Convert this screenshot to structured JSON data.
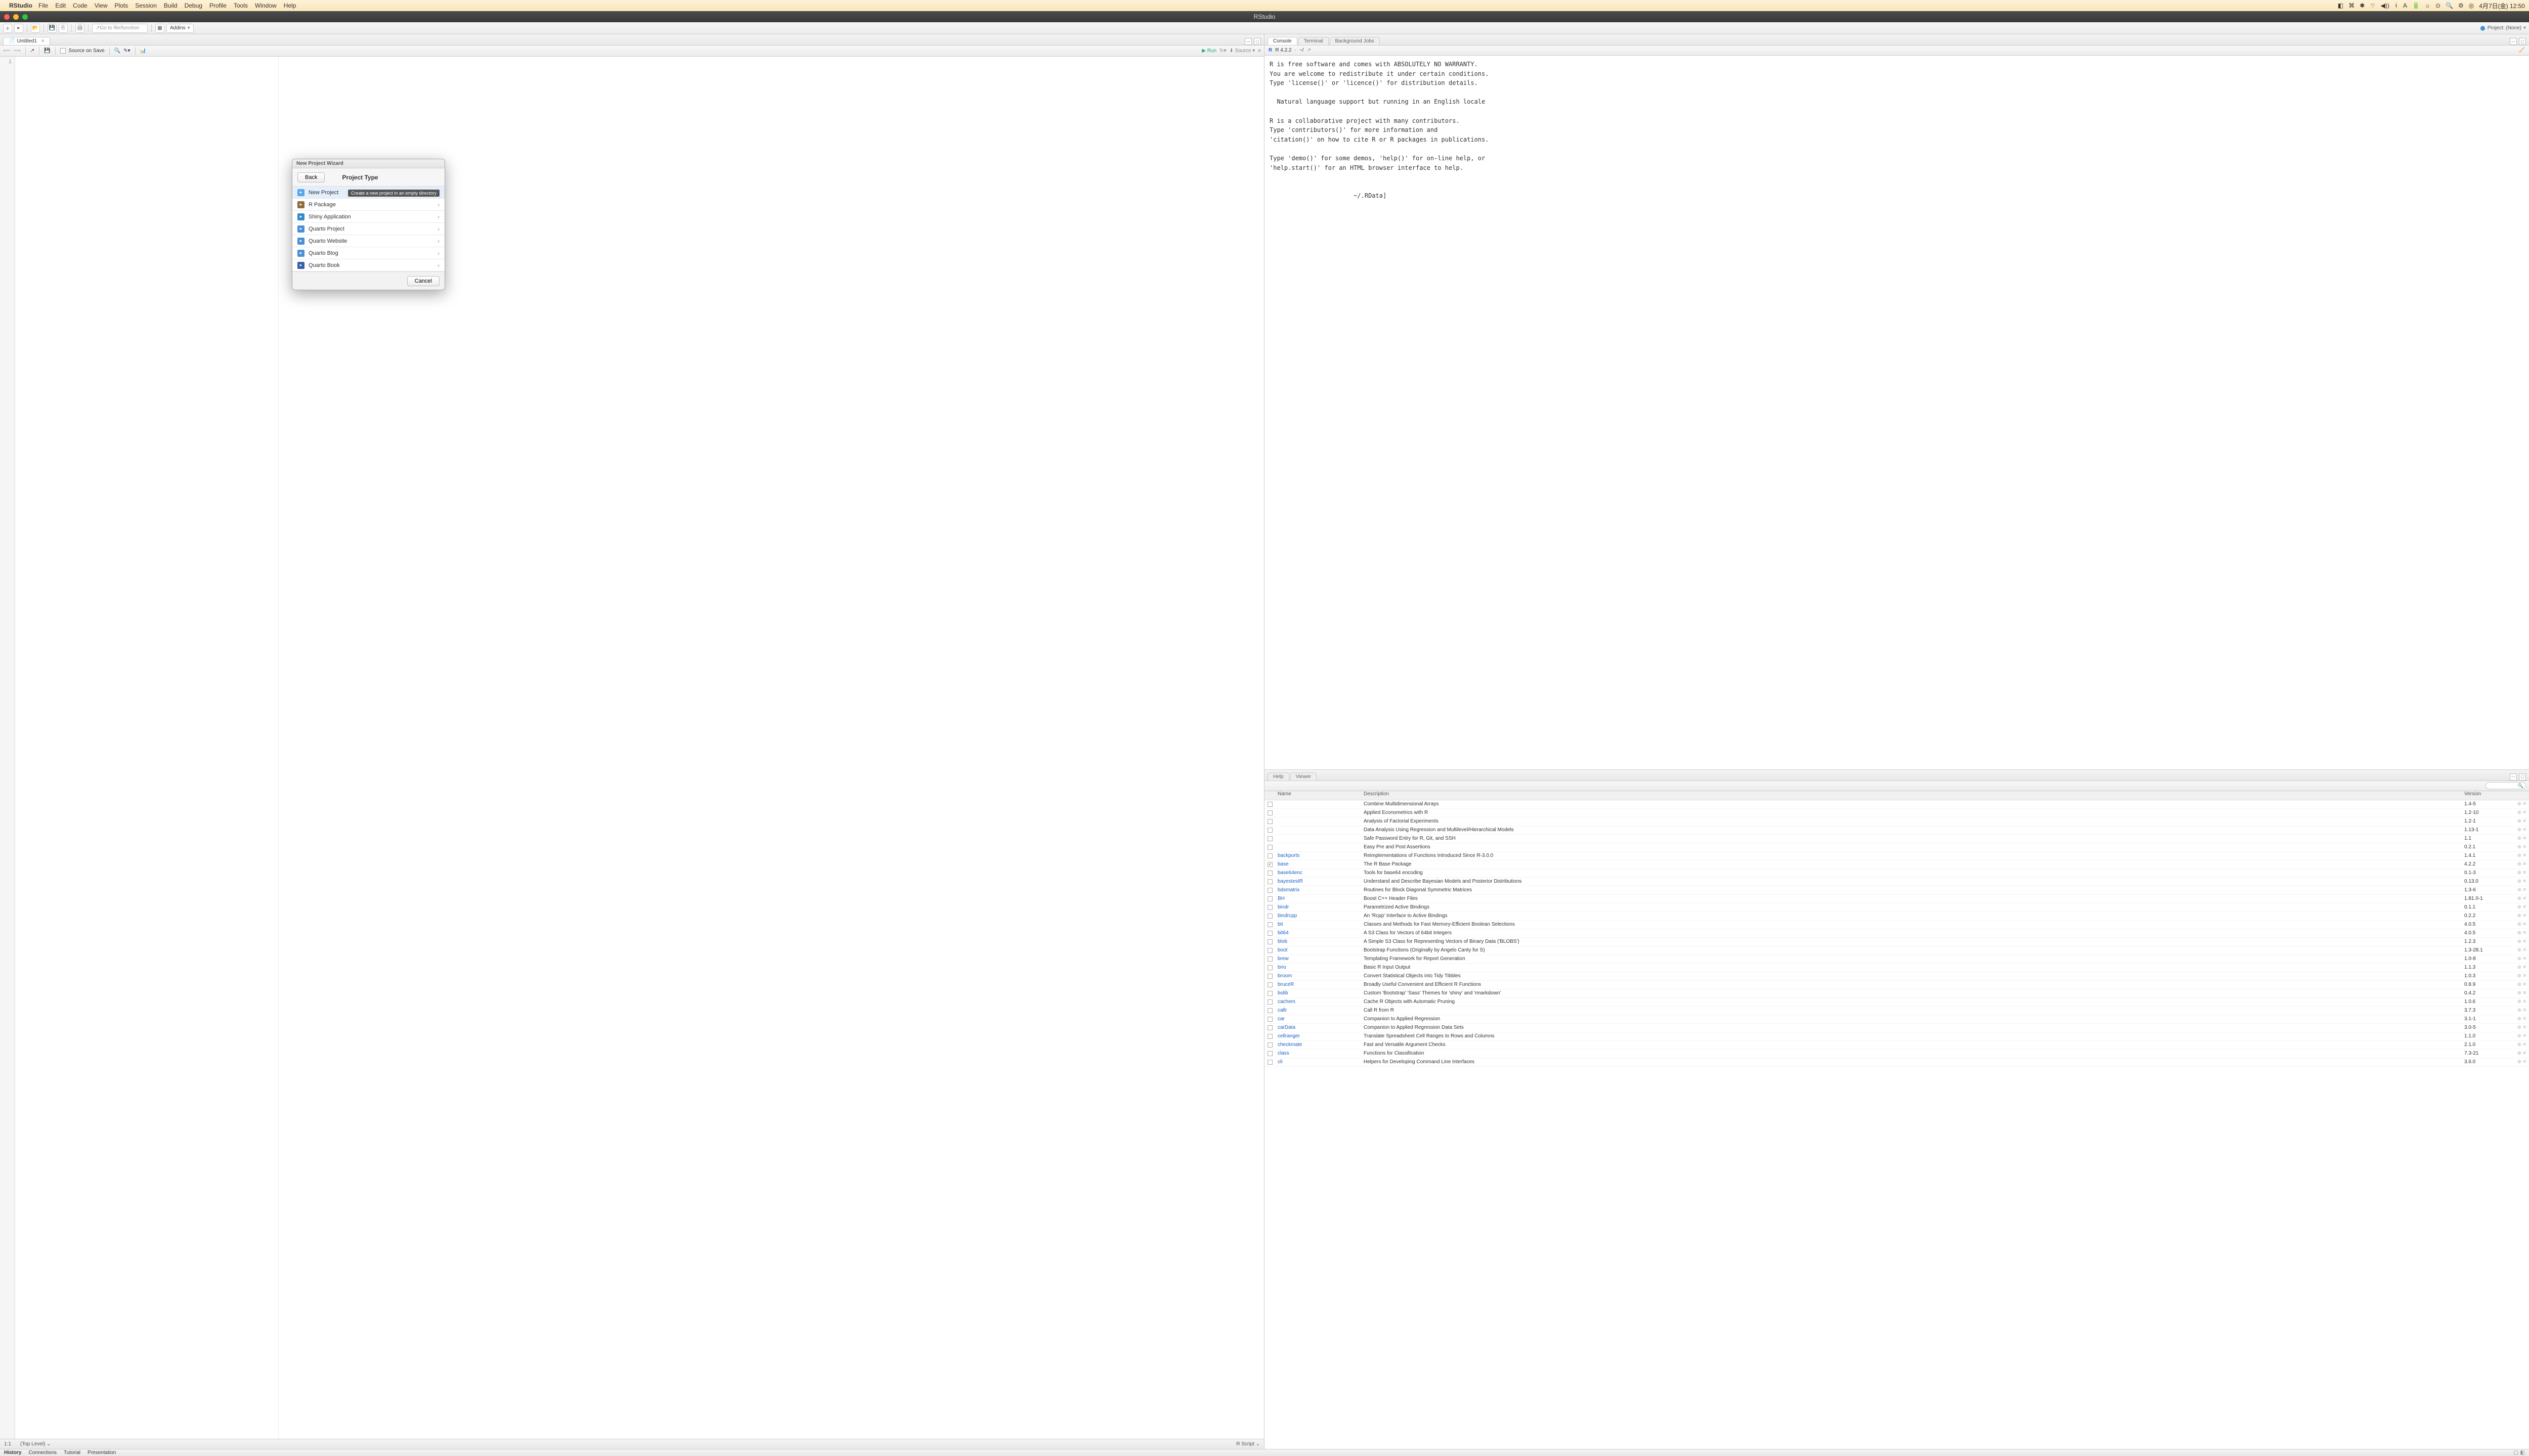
{
  "mac": {
    "app": "RStudio",
    "menus": [
      "File",
      "Edit",
      "Code",
      "View",
      "Plots",
      "Session",
      "Build",
      "Debug",
      "Profile",
      "Tools",
      "Window",
      "Help"
    ],
    "clock": "4月7日(金) 12:50"
  },
  "window": {
    "title": "RStudio"
  },
  "toolbar": {
    "goto_placeholder": "Go to file/function",
    "addins": "Addins",
    "project": "Project: (None)"
  },
  "source": {
    "tab": "Untitled1",
    "source_on_save": "Source on Save",
    "run": "Run",
    "source_btn": "Source",
    "line1": "1",
    "status_pos": "1:1",
    "status_scope": "(Top Level)",
    "status_lang": "R Script"
  },
  "console": {
    "tabs": [
      "Console",
      "Terminal",
      "Background Jobs"
    ],
    "version": "R 4.2.2",
    "path": "~/",
    "text": "R is free software and comes with ABSOLUTELY NO WARRANTY.\nYou are welcome to redistribute it under certain conditions.\nType 'license()' or 'licence()' for distribution details.\n\n  Natural language support but running in an English locale\n\nR is a collaborative project with many contributors.\nType 'contributors()' for more information and\n'citation()' on how to cite R or R packages in publications.\n\nType 'demo()' for some demos, 'help()' for on-line help, or\n'help.start()' for an HTML browser interface to help.\n\n\n                       ~/.RData]"
  },
  "pkg": {
    "tabs": [
      "Help",
      "Viewer"
    ],
    "headers": {
      "name": "Name",
      "desc": "Description",
      "ver": "Version"
    },
    "rows": [
      {
        "chk": false,
        "name": "",
        "desc": "Combine Multidimensional Arrays",
        "ver": "1.4-5"
      },
      {
        "chk": false,
        "name": "",
        "desc": "Applied Econometrics with R",
        "ver": "1.2-10"
      },
      {
        "chk": false,
        "name": "",
        "desc": "Analysis of Factorial Experiments",
        "ver": "1.2-1"
      },
      {
        "chk": false,
        "name": "",
        "desc": "Data Analysis Using Regression and Multilevel/Hierarchical Models",
        "ver": "1.13-1"
      },
      {
        "chk": false,
        "name": "",
        "desc": "Safe Password Entry for R, Git, and SSH",
        "ver": "1.1"
      },
      {
        "chk": false,
        "name": "",
        "desc": "Easy Pre and Post Assertions",
        "ver": "0.2.1"
      },
      {
        "chk": false,
        "name": "backports",
        "desc": "Reimplementations of Functions Introduced Since R-3.0.0",
        "ver": "1.4.1"
      },
      {
        "chk": true,
        "name": "base",
        "desc": "The R Base Package",
        "ver": "4.2.2"
      },
      {
        "chk": false,
        "name": "base64enc",
        "desc": "Tools for base64 encoding",
        "ver": "0.1-3"
      },
      {
        "chk": false,
        "name": "bayestestR",
        "desc": "Understand and Describe Bayesian Models and Posterior Distributions",
        "ver": "0.13.0"
      },
      {
        "chk": false,
        "name": "bdsmatrix",
        "desc": "Routines for Block Diagonal Symmetric Matrices",
        "ver": "1.3-6"
      },
      {
        "chk": false,
        "name": "BH",
        "desc": "Boost C++ Header Files",
        "ver": "1.81.0-1"
      },
      {
        "chk": false,
        "name": "bindr",
        "desc": "Parametrized Active Bindings",
        "ver": "0.1.1"
      },
      {
        "chk": false,
        "name": "bindrcpp",
        "desc": "An 'Rcpp' Interface to Active Bindings",
        "ver": "0.2.2"
      },
      {
        "chk": false,
        "name": "bit",
        "desc": "Classes and Methods for Fast Memory-Efficient Boolean Selections",
        "ver": "4.0.5"
      },
      {
        "chk": false,
        "name": "bit64",
        "desc": "A S3 Class for Vectors of 64bit Integers",
        "ver": "4.0.5"
      },
      {
        "chk": false,
        "name": "blob",
        "desc": "A Simple S3 Class for Representing Vectors of Binary Data ('BLOBS')",
        "ver": "1.2.3"
      },
      {
        "chk": false,
        "name": "boot",
        "desc": "Bootstrap Functions (Originally by Angelo Canty for S)",
        "ver": "1.3-28.1"
      },
      {
        "chk": false,
        "name": "brew",
        "desc": "Templating Framework for Report Generation",
        "ver": "1.0-8"
      },
      {
        "chk": false,
        "name": "brio",
        "desc": "Basic R Input Output",
        "ver": "1.1.3"
      },
      {
        "chk": false,
        "name": "broom",
        "desc": "Convert Statistical Objects into Tidy Tibbles",
        "ver": "1.0.3"
      },
      {
        "chk": false,
        "name": "bruceR",
        "desc": "Broadly Useful Convenient and Efficient R Functions",
        "ver": "0.8.9"
      },
      {
        "chk": false,
        "name": "bslib",
        "desc": "Custom 'Bootstrap' 'Sass' Themes for 'shiny' and 'rmarkdown'",
        "ver": "0.4.2"
      },
      {
        "chk": false,
        "name": "cachem",
        "desc": "Cache R Objects with Automatic Pruning",
        "ver": "1.0.6"
      },
      {
        "chk": false,
        "name": "callr",
        "desc": "Call R from R",
        "ver": "3.7.3"
      },
      {
        "chk": false,
        "name": "car",
        "desc": "Companion to Applied Regression",
        "ver": "3.1-1"
      },
      {
        "chk": false,
        "name": "carData",
        "desc": "Companion to Applied Regression Data Sets",
        "ver": "3.0-5"
      },
      {
        "chk": false,
        "name": "cellranger",
        "desc": "Translate Spreadsheet Cell Ranges to Rows and Columns",
        "ver": "1.1.0"
      },
      {
        "chk": false,
        "name": "checkmate",
        "desc": "Fast and Versatile Argument Checks",
        "ver": "2.1.0"
      },
      {
        "chk": false,
        "name": "class",
        "desc": "Functions for Classification",
        "ver": "7.3-21"
      },
      {
        "chk": false,
        "name": "cli",
        "desc": "Helpers for Developing Command Line Interfaces",
        "ver": "3.6.0"
      }
    ]
  },
  "dialog": {
    "title": "New Project Wizard",
    "back": "Back",
    "heading": "Project Type",
    "tooltip": "Create a new project in an empty directory",
    "items": [
      {
        "label": "New Project",
        "color": "#5aa7e8"
      },
      {
        "label": "R Package",
        "color": "#8c6e3f"
      },
      {
        "label": "Shiny Application",
        "color": "#3a89c9"
      },
      {
        "label": "Quarto Project",
        "color": "#4b8fd6"
      },
      {
        "label": "Quarto Website",
        "color": "#4b8fd6"
      },
      {
        "label": "Quarto Blog",
        "color": "#4b8fd6"
      },
      {
        "label": "Quarto Book",
        "color": "#3a5fa8"
      }
    ],
    "cancel": "Cancel"
  },
  "bottom": {
    "tabs": [
      "History",
      "Connections",
      "Tutorial",
      "Presentation"
    ]
  }
}
